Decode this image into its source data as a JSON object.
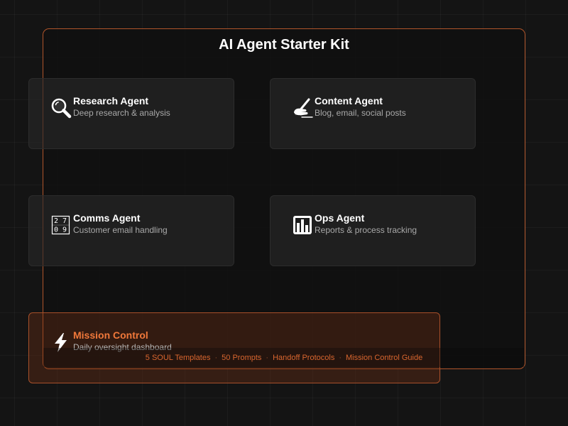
{
  "page": {
    "title": "AI Agent Starter Kit"
  },
  "agents": [
    {
      "title": "Research Agent",
      "subtitle": "Deep research & analysis",
      "icon": "magnifier-icon"
    },
    {
      "title": "Content Agent",
      "subtitle": "Blog, email, social posts",
      "icon": "writing-hand-icon"
    },
    {
      "title": "Comms Agent",
      "subtitle": "Customer email handling",
      "icon": "number-grid-icon"
    },
    {
      "title": "Ops Agent",
      "subtitle": "Reports & process tracking",
      "icon": "bar-chart-icon"
    }
  ],
  "comms_icon_digits": [
    "2",
    "7",
    "0",
    "9"
  ],
  "mission": {
    "title": "Mission Control",
    "subtitle": "Daily oversight dashboard",
    "icon": "lightning-icon"
  },
  "footer": {
    "items": [
      "5 SOUL Templates",
      "50 Prompts",
      "Handoff Protocols",
      "Mission Control Guide"
    ],
    "separator": "·"
  },
  "colors": {
    "accent": "#f0783a",
    "frame_border": "#b0552a",
    "background": "#141414",
    "card_background": "#282828",
    "subtitle_text": "#a9a9a9"
  }
}
